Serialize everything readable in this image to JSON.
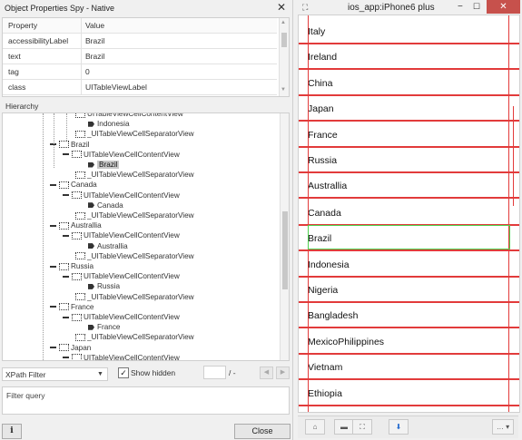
{
  "left": {
    "title": "Object Properties Spy - Native",
    "close_glyph": "✕",
    "properties": {
      "header": {
        "property": "Property",
        "value": "Value"
      },
      "rows": [
        {
          "key": "accessibilityLabel",
          "value": "Brazil"
        },
        {
          "key": "text",
          "value": "Brazil"
        },
        {
          "key": "tag",
          "value": "0"
        },
        {
          "key": "class",
          "value": "UITableViewLabel"
        }
      ]
    },
    "hierarchy_label": "Hierarchy",
    "tree": [
      {
        "text": "UITableViewCellContentView",
        "kind": "box",
        "indent": 80,
        "minus": false
      },
      {
        "text": "Indonesia",
        "kind": "tag",
        "indent": 94,
        "minus": false
      },
      {
        "text": "_UITableViewCellSeparatorView",
        "kind": "box",
        "indent": 80,
        "minus": false
      },
      {
        "text": "Brazil",
        "kind": "box",
        "indent": 52,
        "minus": true
      },
      {
        "text": "UITableViewCellContentView",
        "kind": "box",
        "indent": 66,
        "minus": true
      },
      {
        "text": "Brazil",
        "kind": "tag",
        "indent": 94,
        "minus": false,
        "selected": true
      },
      {
        "text": "_UITableViewCellSeparatorView",
        "kind": "box",
        "indent": 80,
        "minus": false
      },
      {
        "text": "Canada",
        "kind": "box",
        "indent": 52,
        "minus": true
      },
      {
        "text": "UITableViewCellContentView",
        "kind": "box",
        "indent": 66,
        "minus": true
      },
      {
        "text": "Canada",
        "kind": "tag",
        "indent": 94,
        "minus": false
      },
      {
        "text": "_UITableViewCellSeparatorView",
        "kind": "box",
        "indent": 80,
        "minus": false
      },
      {
        "text": "Australlia",
        "kind": "box",
        "indent": 52,
        "minus": true
      },
      {
        "text": "UITableViewCellContentView",
        "kind": "box",
        "indent": 66,
        "minus": true
      },
      {
        "text": "Australlia",
        "kind": "tag",
        "indent": 94,
        "minus": false
      },
      {
        "text": "_UITableViewCellSeparatorView",
        "kind": "box",
        "indent": 80,
        "minus": false
      },
      {
        "text": "Russia",
        "kind": "box",
        "indent": 52,
        "minus": true
      },
      {
        "text": "UITableViewCellContentView",
        "kind": "box",
        "indent": 66,
        "minus": true
      },
      {
        "text": "Russia",
        "kind": "tag",
        "indent": 94,
        "minus": false
      },
      {
        "text": "_UITableViewCellSeparatorView",
        "kind": "box",
        "indent": 80,
        "minus": false
      },
      {
        "text": "France",
        "kind": "box",
        "indent": 52,
        "minus": true
      },
      {
        "text": "UITableViewCellContentView",
        "kind": "box",
        "indent": 66,
        "minus": true
      },
      {
        "text": "France",
        "kind": "tag",
        "indent": 94,
        "minus": false
      },
      {
        "text": "_UITableViewCellSeparatorView",
        "kind": "box",
        "indent": 80,
        "minus": false
      },
      {
        "text": "Japan",
        "kind": "box",
        "indent": 52,
        "minus": true
      },
      {
        "text": "UITableViewCellContentView",
        "kind": "box",
        "indent": 66,
        "minus": true
      }
    ],
    "xpath_filter": "XPath Filter",
    "show_hidden_label": "Show hidden",
    "show_hidden_checked": true,
    "page_slash": "/ -",
    "filter_placeholder": "Filter query",
    "info_label": "i",
    "close_label": "Close"
  },
  "right": {
    "title": "ios_app:iPhone6 plus",
    "min_glyph": "−",
    "max_glyph": "☐",
    "close_glyph": "✕",
    "countries": [
      "Italy",
      "Ireland",
      "China",
      "Japan",
      "France",
      "Russia",
      "Australlia",
      "Canada",
      "Brazil",
      "Indonesia",
      "Nigeria",
      "Bangladesh",
      "MexicoPhilippines",
      "Vietnam",
      "Ethiopia"
    ],
    "selected_country": "Brazil",
    "highlight_color": "#e23b3b",
    "selection_color": "#4fd04f",
    "close_color": "#c7514c"
  }
}
